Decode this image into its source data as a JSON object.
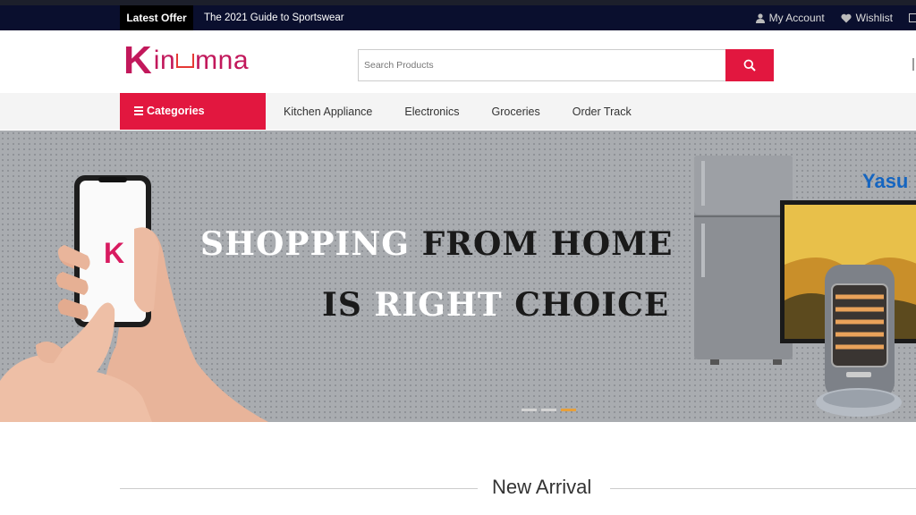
{
  "topbar": {
    "offer_label": "Latest Offer",
    "offer_text": "The 2021 Guide to Sportswear",
    "account_label": "My Account",
    "wishlist_label": "Wishlist",
    "icons": [
      "user-icon",
      "heart-icon"
    ]
  },
  "header": {
    "logo_k": "K",
    "logo_rest_a": "in",
    "logo_rest_b": "mna",
    "search_placeholder": "Search Products",
    "search_icon": "search-icon",
    "accent": "#e2173f",
    "brand": "#c2185b"
  },
  "nav": {
    "categories_label": "Categories",
    "items": [
      "Kitchen Appliance",
      "Electronics",
      "Groceries",
      "Order Track"
    ]
  },
  "banner": {
    "line1_white": "SHOPPING",
    "line1_dark": "FROM HOME",
    "line2_dark_a": "IS",
    "line2_white": "RIGHT",
    "line2_dark_b": "CHOICE",
    "phone_letter": "K",
    "tv_brand": "Yasu",
    "slides": 3,
    "active_slide": 3,
    "active_dot_color": "#e8a03a"
  },
  "section": {
    "title": "New Arrival"
  }
}
